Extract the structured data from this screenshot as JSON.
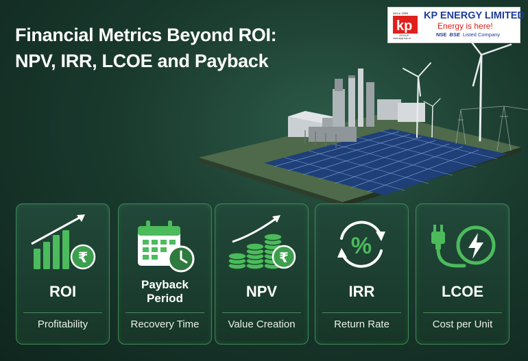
{
  "header": {
    "title_line1": "Financial Metrics Beyond ROI:",
    "title_line2": "NPV, IRR, LCOE and Payback"
  },
  "logo": {
    "company": "KP ENERGY LIMITED",
    "tagline": "Energy is here!",
    "exchange1": "NSE",
    "exchange2": "BSE",
    "listed": "Listed Company",
    "since": "Since 1994",
    "group": "GROUP",
    "website": "www.kpgroup.co"
  },
  "colors": {
    "background": "#1a3a2e",
    "accent_green": "#4cbb5c",
    "card_border": "#3f8a55",
    "brand_blue": "#1d3b9c",
    "brand_red": "#e0201c"
  },
  "cards": [
    {
      "title": "ROI",
      "subtitle": "Profitability",
      "icon": "bar-chart-rupee-icon"
    },
    {
      "title_line1": "Payback",
      "title_line2": "Period",
      "subtitle": "Recovery Time",
      "icon": "calendar-clock-icon"
    },
    {
      "title": "NPV",
      "subtitle": "Value Creation",
      "icon": "coins-rupee-icon"
    },
    {
      "title": "IRR",
      "subtitle": "Return Rate",
      "icon": "percent-cycle-icon"
    },
    {
      "title": "LCOE",
      "subtitle": "Cost per Unit",
      "icon": "plug-bolt-icon"
    }
  ]
}
